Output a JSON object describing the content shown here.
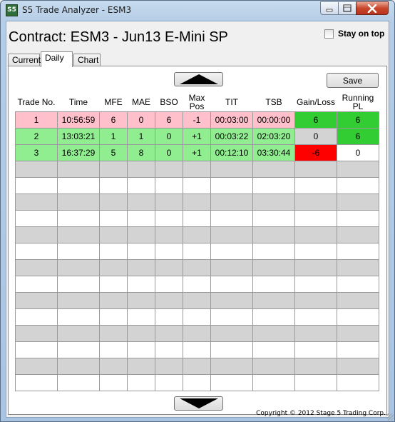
{
  "window": {
    "title": "S5 Trade Analyzer - ESM3",
    "icon_text": "S5",
    "icon": "app-icon"
  },
  "header": {
    "contract_title": "Contract: ESM3 - Jun13 E-Mini SP",
    "stay_on_top_label": "Stay on top",
    "stay_on_top_checked": false
  },
  "tabs": [
    {
      "label": "Current",
      "active": false
    },
    {
      "label": "Daily",
      "active": true
    },
    {
      "label": "Chart",
      "active": false
    }
  ],
  "toolbar": {
    "save_label": "Save",
    "scroll_up_icon": "triangle-up-icon",
    "scroll_down_icon": "triangle-down-icon"
  },
  "table": {
    "columns": [
      "Trade No.",
      "Time",
      "MFE",
      "MAE",
      "BSO",
      "Max Pos",
      "TIT",
      "TSB",
      "Gain/Loss",
      "Running PL"
    ],
    "rows": [
      {
        "cells": [
          "1",
          "10:56:59",
          "6",
          "0",
          "6",
          "-1",
          "00:03:00",
          "00:00:00",
          "6",
          "6"
        ],
        "row_color": "#ffc0cb",
        "gain_color": "#32cd32",
        "pl_color": "#32cd32"
      },
      {
        "cells": [
          "2",
          "13:03:21",
          "1",
          "1",
          "0",
          "+1",
          "00:03:22",
          "02:03:20",
          "0",
          "6"
        ],
        "row_color": "#90ee90",
        "gain_color": "#d3d3d3",
        "pl_color": "#32cd32"
      },
      {
        "cells": [
          "3",
          "16:37:29",
          "5",
          "8",
          "0",
          "+1",
          "00:12:10",
          "03:30:44",
          "-6",
          "0"
        ],
        "row_color": "#90ee90",
        "gain_color": "#ff0000",
        "pl_color": "#ffffff"
      }
    ],
    "empty_row_count": 14
  },
  "footer": {
    "copyright": "Copyright © 2012 Stage 5 Trading Corp."
  },
  "colors": {
    "loss_row": "#ffc0cb",
    "win_row": "#90ee90",
    "positive": "#32cd32",
    "negative": "#ff0000",
    "neutral": "#d3d3d3"
  }
}
